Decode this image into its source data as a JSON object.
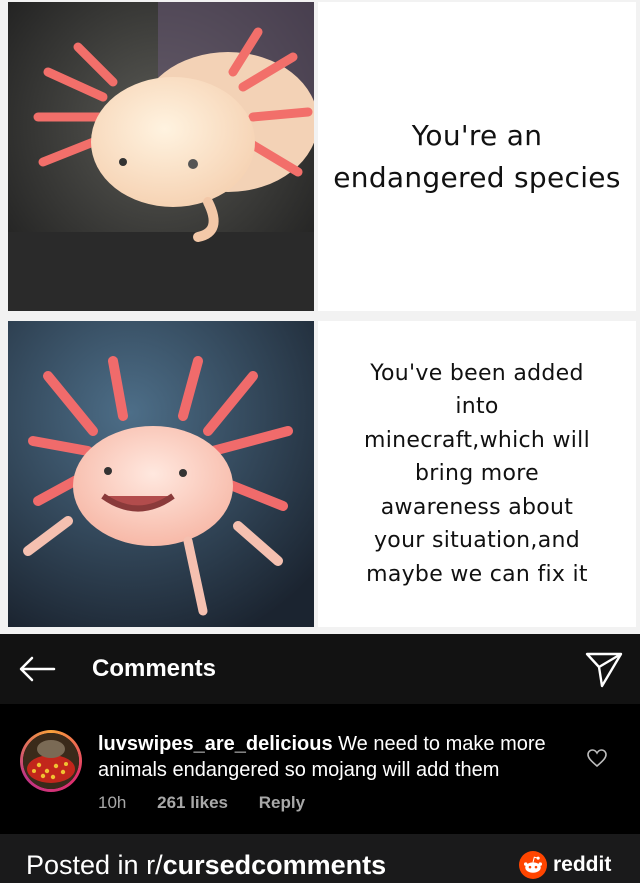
{
  "meme": {
    "panel1_text": "You're an\nendangered species",
    "panel2_text": "You've been added\ninto\nminecraft,which will\nbring more\nawareness about\nyour situation,and\nmaybe we can fix it"
  },
  "header": {
    "title": "Comments",
    "back_icon": "arrow-left-icon",
    "send_icon": "paper-plane-icon"
  },
  "comment": {
    "username": "luvswipes_are_delicious",
    "text": "We need to make more animals endangered so mojang will add them",
    "time": "10h",
    "likes": "261 likes",
    "reply": "Reply"
  },
  "footer": {
    "prefix": "Posted in r/",
    "subreddit": "cursedcomments",
    "brand": "reddit"
  },
  "colors": {
    "header_bg": "#121212",
    "comment_bg": "#000000",
    "footer_bg": "#1a1a1b",
    "reddit_orange": "#ff4500"
  }
}
